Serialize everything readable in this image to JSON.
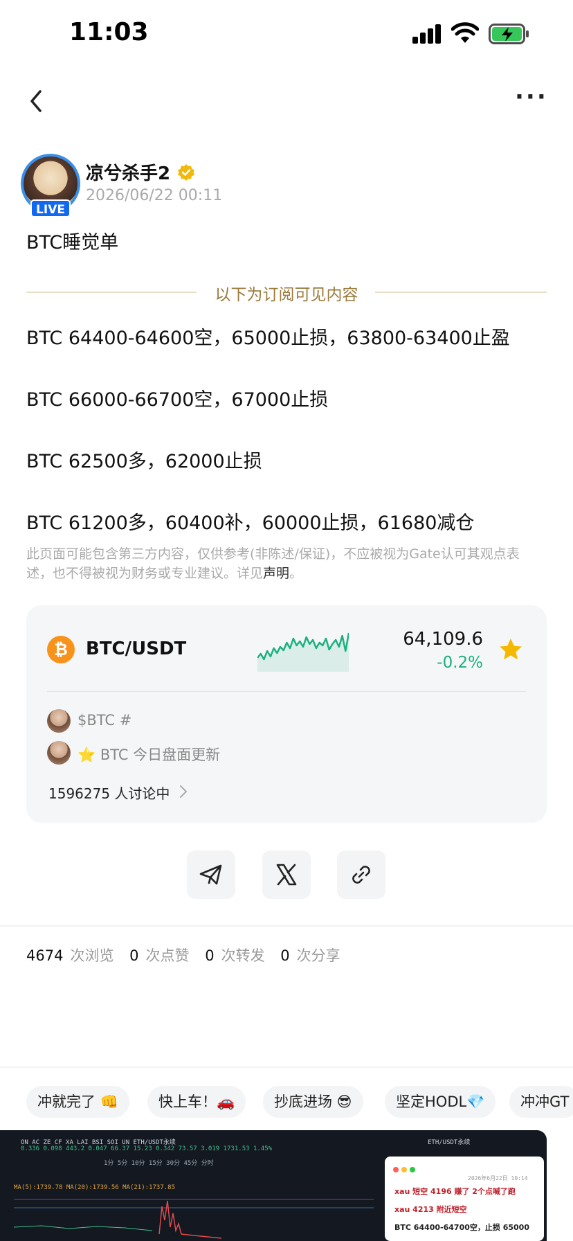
{
  "status_bar": {
    "time": "11:03"
  },
  "author": {
    "name": "凉兮杀手2",
    "live_label": "LIVE",
    "post_time": "2026/06/22 00:11"
  },
  "post": {
    "title": "BTC睡觉单",
    "divider_text": "以下为订阅可见内容",
    "lines": [
      "BTC 64400-64600空，65000止损，63800-63400止盈",
      "BTC 66000-66700空，67000止损",
      "BTC 62500多，62000止损",
      "BTC 61200多，60400补，60000止损，61680减仓"
    ],
    "disclaimer": "此页面可能包含第三方内容，仅供参考(非陈述/保证)，不应被视为Gate认可其观点表述，也不得被视为财务或专业建议。详见",
    "disclaimer_link": "声明",
    "disclaimer_end": "。"
  },
  "ticker": {
    "pair": "BTC/USDT",
    "coin_symbol": "₿",
    "price": "64,109.6",
    "change": "-0.2%",
    "change_color": "#1bb07f",
    "starred": true,
    "spark": [
      40,
      34,
      42,
      30,
      38,
      26,
      33,
      24,
      29,
      18,
      26,
      12,
      22,
      16,
      24,
      10,
      20,
      14,
      26,
      18,
      22,
      12,
      28,
      20,
      14,
      24,
      8,
      30,
      4
    ]
  },
  "topics": [
    {
      "text": "$BTC #"
    },
    {
      "emoji": "⭐",
      "text": "BTC 今日盘面更新"
    }
  ],
  "discussion": {
    "count": "1596275",
    "label": "人讨论中"
  },
  "share": [
    {
      "name": "telegram-icon"
    },
    {
      "name": "x-icon"
    },
    {
      "name": "link-icon"
    }
  ],
  "stats": {
    "views": "4674",
    "views_label": "次浏览",
    "likes": "0",
    "likes_label": "次点赞",
    "reposts": "0",
    "reposts_label": "次转发",
    "shares": "0",
    "shares_label": "次分享"
  },
  "chips": [
    "冲就完了 👊",
    "快上车！🚗",
    "抄底进场 😎",
    "坚定HODL💎",
    "冲冲GT"
  ],
  "preview": {
    "header_row": "ON  AC  ZE  CF  XA  LAI  BSI  SOI  UN  ETH/USDT永续",
    "values_row": "0.336 0.098 443.2 0.047 66.37 15.23 0.342 73.57 3.019  1731.53 1.45%",
    "tabs_row": "1分  5分  10分  15分  30分  45分  分时",
    "ma_row": "MA(5):1739.78  MA(20):1739.56  MA(21):1737.85",
    "right_title": "ETH/USDT永续",
    "panel_date": "2026年6月22日 10:14",
    "panel_lines": [
      "xau 短空 4196 赚了 2个点喊了跑",
      "xau 4213 附近短空",
      "BTC 64400-64700空，止损 65000"
    ]
  }
}
